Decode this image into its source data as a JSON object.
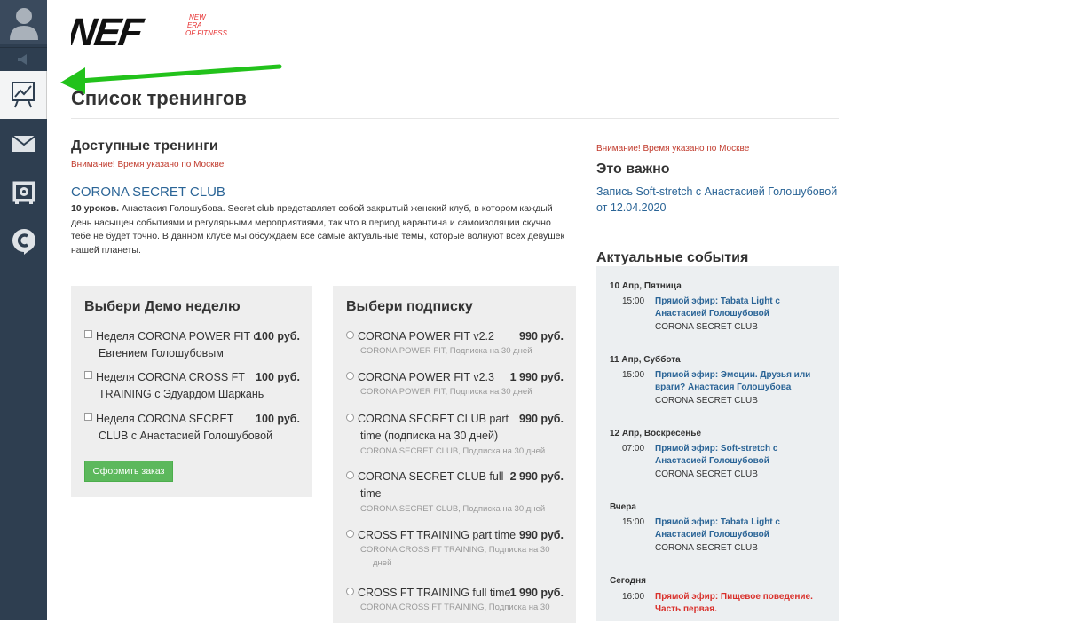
{
  "sidebar": {
    "icons": [
      "user-avatar-icon",
      "speaker-icon",
      "chart-icon",
      "mail-icon",
      "safe-icon",
      "c-logo-icon"
    ]
  },
  "logo": {
    "text": "NEF",
    "tagline": [
      "NEW",
      "ERA",
      "OF FITNESS"
    ]
  },
  "page": {
    "title": "Список тренингов"
  },
  "available": {
    "title": "Доступные тренинги",
    "warning": "Внимание! Время указано по Москве",
    "course": {
      "name": "CORONA SECRET CLUB",
      "lessons": "10 уроков.",
      "description": " Анастасия Голошубова. Secret club представляет собой закрытый женский клуб, в котором каждый день насыщен событиями и регулярными мероприятиями, так что в период карантина и самоизоляции скучно тебе не будет точно. В данном клубе мы обсуждаем все самые актуальные темы, которые волнуют всех девушек нашей планеты."
    }
  },
  "demo": {
    "title": "Выбери Демо неделю",
    "options": [
      {
        "line1": "Неделя CORONA POWER FIT с",
        "line2": "Евгением Голошубовым",
        "price": "100 руб."
      },
      {
        "line1": "Неделя CORONA CROSS FT",
        "line2": "TRAINING с Эдуардом Шаркань",
        "price": "100 руб."
      },
      {
        "line1": "Неделя CORONA SECRET",
        "line2": "CLUB с Анастасией Голошубовой",
        "price": "100 руб."
      }
    ],
    "order_button": "Оформить заказ"
  },
  "subscription": {
    "title": "Выбери подписку",
    "options": [
      {
        "line1": "CORONA POWER FIT v2.2",
        "line2": "",
        "price": "990 руб.",
        "sub1": "CORONA POWER FIT, Подписка на 30 дней",
        "sub2": ""
      },
      {
        "line1": "CORONA POWER FIT v2.3",
        "line2": "",
        "price": "1 990 руб.",
        "sub1": "CORONA POWER FIT, Подписка на 30 дней",
        "sub2": ""
      },
      {
        "line1": "CORONA SECRET CLUB part",
        "line2": "time (подписка на 30 дней)",
        "price": "990 руб.",
        "sub1": "CORONA SECRET CLUB, Подписка на 30 дней",
        "sub2": ""
      },
      {
        "line1": "CORONA SECRET CLUB full",
        "line2": "time",
        "price": "2 990 руб.",
        "sub1": "CORONA SECRET CLUB, Подписка на 30 дней",
        "sub2": ""
      },
      {
        "line1": "CROSS FT TRAINING part time",
        "line2": "",
        "price": "990 руб.",
        "sub1": "CORONA CROSS FT TRAINING, Подписка на 30",
        "sub2": "дней"
      },
      {
        "line1": "CROSS FT TRAINING full time",
        "line2": "",
        "price": "1 990 руб.",
        "sub1": "CORONA CROSS FT TRAINING, Подписка на 30",
        "sub2": ""
      }
    ]
  },
  "important": {
    "warning": "Внимание! Время указано по Москве",
    "title": "Это важно",
    "link_line1": "Запись Soft-stretch с Анастасией Голошубовой",
    "link_line2": "от 12.04.2020"
  },
  "events": {
    "title": "Актуальные события",
    "days": [
      {
        "day": "10 Апр, Пятница",
        "time": "15:00",
        "l1": "Прямой эфир: Tabata Light с",
        "l2": "Анастасией Голошубовой",
        "club": "CORONA SECRET CLUB",
        "red": false
      },
      {
        "day": "11 Апр, Суббота",
        "time": "15:00",
        "l1": "Прямой эфир: Эмоции. Друзья или",
        "l2": "враги? Анастасия Голошубова",
        "club": "CORONA SECRET CLUB",
        "red": false
      },
      {
        "day": "12 Апр, Воскресенье",
        "time": "07:00",
        "l1": "Прямой эфир: Soft-stretch с",
        "l2": "Анастасией Голошубовой",
        "club": "CORONA SECRET CLUB",
        "red": false
      },
      {
        "day": "Вчера",
        "time": "15:00",
        "l1": "Прямой эфир: Tabata Light с",
        "l2": "Анастасией Голошубовой",
        "club": "CORONA SECRET CLUB",
        "red": false
      },
      {
        "day": "Сегодня",
        "time": "16:00",
        "l1": "Прямой эфир: Пищевое поведение.",
        "l2": "Часть первая.",
        "club": "",
        "red": true
      }
    ]
  },
  "colors": {
    "sidebar": "#2e3e50",
    "link": "#2a6496",
    "warning": "#c0392b",
    "button": "#5cb85c",
    "arrow": "#22c21b"
  }
}
